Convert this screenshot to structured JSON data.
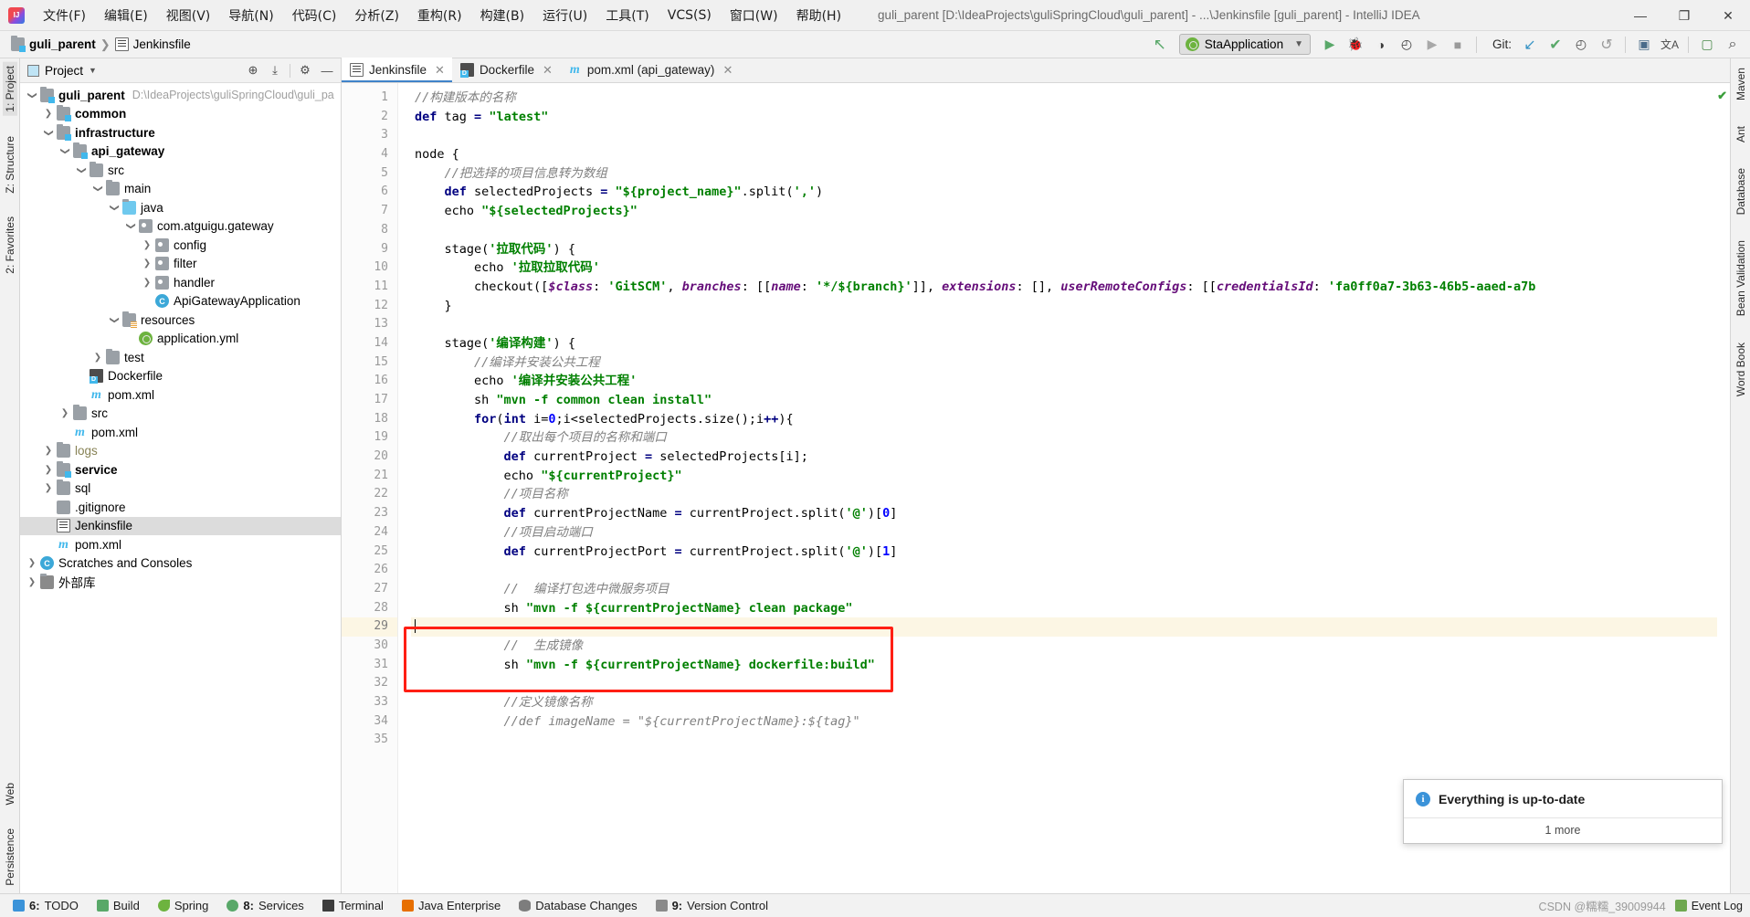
{
  "titlebar": {
    "menus": [
      {
        "label": "文件(F)"
      },
      {
        "label": "编辑(E)"
      },
      {
        "label": "视图(V)"
      },
      {
        "label": "导航(N)"
      },
      {
        "label": "代码(C)"
      },
      {
        "label": "分析(Z)"
      },
      {
        "label": "重构(R)"
      },
      {
        "label": "构建(B)"
      },
      {
        "label": "运行(U)"
      },
      {
        "label": "工具(T)"
      },
      {
        "label": "VCS(S)"
      },
      {
        "label": "窗口(W)"
      },
      {
        "label": "帮助(H)"
      }
    ],
    "window_title": "guli_parent [D:\\IdeaProjects\\guliSpringCloud\\guli_parent] - ...\\Jenkinsfile [guli_parent] - IntelliJ IDEA",
    "minimize": "—",
    "maximize": "❐",
    "close": "✕"
  },
  "toolbar": {
    "breadcrumb": [
      {
        "label": "guli_parent",
        "icon": "module-folder-icon"
      },
      {
        "label": "Jenkinsfile",
        "icon": "jenkins-file-icon"
      }
    ],
    "build_label": "↖",
    "run_config": "StaApplication",
    "run_label": "▶",
    "debug_label": "🐞",
    "coverage_label": "◑",
    "profile_label": "◴",
    "rerun_label": "▶",
    "stop_label": "■",
    "git_label": "Git:",
    "git_update": "↙",
    "git_commit": "✔",
    "git_history": "◴",
    "git_rollback": "↺",
    "project_structure": "▣",
    "translate": "文A",
    "browser": "▢",
    "search": "⌕"
  },
  "left_rail": {
    "top": [
      {
        "label": "1: Project",
        "active": true
      },
      {
        "label": "Z: Structure",
        "active": false
      },
      {
        "label": "2: Favorites",
        "active": false
      }
    ],
    "bottom": [
      {
        "label": "Web"
      },
      {
        "label": "Persistence"
      }
    ]
  },
  "right_rail": {
    "items": [
      {
        "label": "Maven"
      },
      {
        "label": "Ant"
      },
      {
        "label": "Database"
      },
      {
        "label": "Bean Validation"
      },
      {
        "label": "Word Book"
      }
    ]
  },
  "project_panel": {
    "title": "Project",
    "icons": {
      "locate": "⊕",
      "collapse": "⤓",
      "settings": "⚙",
      "hide": "—"
    },
    "tree": [
      {
        "depth": 0,
        "twisty": "open",
        "icon": "module-folder-icon",
        "label": "guli_parent",
        "bold": true,
        "path": "D:\\IdeaProjects\\guliSpringCloud\\guli_pa"
      },
      {
        "depth": 1,
        "twisty": "closed",
        "icon": "module-folder-icon",
        "label": "common",
        "bold": true,
        "path": ""
      },
      {
        "depth": 1,
        "twisty": "open",
        "icon": "module-folder-icon",
        "label": "infrastructure",
        "bold": true,
        "path": ""
      },
      {
        "depth": 2,
        "twisty": "open",
        "icon": "module-folder-icon",
        "label": "api_gateway",
        "bold": true,
        "path": ""
      },
      {
        "depth": 3,
        "twisty": "open",
        "icon": "folder-icon",
        "label": "src",
        "bold": false,
        "path": ""
      },
      {
        "depth": 4,
        "twisty": "open",
        "icon": "folder-icon",
        "label": "main",
        "bold": false,
        "path": ""
      },
      {
        "depth": 5,
        "twisty": "open",
        "icon": "source-folder-icon",
        "label": "java",
        "bold": false,
        "path": ""
      },
      {
        "depth": 6,
        "twisty": "open",
        "icon": "package-icon",
        "label": "com.atguigu.gateway",
        "bold": false,
        "path": ""
      },
      {
        "depth": 7,
        "twisty": "closed",
        "icon": "package-icon",
        "label": "config",
        "bold": false,
        "path": ""
      },
      {
        "depth": 7,
        "twisty": "closed",
        "icon": "package-icon",
        "label": "filter",
        "bold": false,
        "path": ""
      },
      {
        "depth": 7,
        "twisty": "closed",
        "icon": "package-icon",
        "label": "handler",
        "bold": false,
        "path": ""
      },
      {
        "depth": 7,
        "twisty": "none",
        "icon": "spring-class-icon",
        "label": "ApiGatewayApplication",
        "bold": false,
        "path": ""
      },
      {
        "depth": 5,
        "twisty": "open",
        "icon": "resources-folder-icon",
        "label": "resources",
        "bold": false,
        "path": ""
      },
      {
        "depth": 6,
        "twisty": "none",
        "icon": "spring-yml-icon",
        "label": "application.yml",
        "bold": false,
        "path": ""
      },
      {
        "depth": 4,
        "twisty": "closed",
        "icon": "folder-icon",
        "label": "test",
        "bold": false,
        "path": ""
      },
      {
        "depth": 3,
        "twisty": "none",
        "icon": "docker-file-icon",
        "label": "Dockerfile",
        "bold": false,
        "path": ""
      },
      {
        "depth": 3,
        "twisty": "none",
        "icon": "maven-file-icon",
        "label": "pom.xml",
        "bold": false,
        "path": ""
      },
      {
        "depth": 2,
        "twisty": "closed",
        "icon": "folder-icon",
        "label": "src",
        "bold": false,
        "path": ""
      },
      {
        "depth": 2,
        "twisty": "none",
        "icon": "maven-file-icon",
        "label": "pom.xml",
        "bold": false,
        "path": ""
      },
      {
        "depth": 1,
        "twisty": "closed",
        "icon": "folder-icon",
        "label": "logs",
        "bold": false,
        "gray": true,
        "path": ""
      },
      {
        "depth": 1,
        "twisty": "closed",
        "icon": "module-folder-icon",
        "label": "service",
        "bold": true,
        "path": ""
      },
      {
        "depth": 1,
        "twisty": "closed",
        "icon": "folder-icon",
        "label": "sql",
        "bold": false,
        "path": ""
      },
      {
        "depth": 1,
        "twisty": "none",
        "icon": "git-file-icon",
        "label": ".gitignore",
        "bold": false,
        "path": ""
      },
      {
        "depth": 1,
        "twisty": "none",
        "icon": "jenkins-file-icon",
        "label": "Jenkinsfile",
        "bold": false,
        "selected": true,
        "path": ""
      },
      {
        "depth": 1,
        "twisty": "none",
        "icon": "maven-file-icon",
        "label": "pom.xml",
        "bold": false,
        "path": ""
      },
      {
        "depth": 0,
        "twisty": "closed",
        "icon": "scratches-icon",
        "label": "Scratches and Consoles",
        "bold": false,
        "path": ""
      },
      {
        "depth": 0,
        "twisty": "closed",
        "icon": "library-icon",
        "label": "外部库",
        "bold": false,
        "path": ""
      }
    ]
  },
  "editor": {
    "tabs": [
      {
        "label": "Jenkinsfile",
        "icon": "jenkins-file-icon",
        "active": true,
        "close": "✕"
      },
      {
        "label": "Dockerfile",
        "icon": "docker-file-icon",
        "active": false,
        "close": "✕"
      },
      {
        "label": "pom.xml (api_gateway)",
        "icon": "maven-file-icon",
        "active": false,
        "close": "✕"
      }
    ],
    "first_line": 1,
    "last_line": 35,
    "current_line": 29,
    "inspection_status": "✔",
    "lines": [
      {
        "n": 1,
        "html": "<span class='cmt'>//构建版本的名称</span>"
      },
      {
        "n": 2,
        "html": "<span class='kw'>def</span> <span class='plain'>tag </span><span class='kw'>=</span> <span class='str'>\"latest\"</span>"
      },
      {
        "n": 3,
        "html": ""
      },
      {
        "n": 4,
        "html": "<span class='plain'>node {</span>"
      },
      {
        "n": 5,
        "html": "    <span class='cmt'>//把选择的项目信息转为数组</span>"
      },
      {
        "n": 6,
        "html": "    <span class='kw'>def</span> <span class='plain'>selectedProjects </span><span class='kw'>=</span> <span class='str'>\"${project_name}\"</span><span class='plain'>.split(</span><span class='str'>','</span><span class='plain'>)</span>"
      },
      {
        "n": 7,
        "html": "    <span class='plain'>echo </span><span class='str'>\"${selectedProjects}\"</span>"
      },
      {
        "n": 8,
        "html": ""
      },
      {
        "n": 9,
        "html": "    <span class='plain'>stage(</span><span class='str'>'拉取代码'</span><span class='plain'>) {</span>"
      },
      {
        "n": 10,
        "html": "        <span class='plain'>echo </span><span class='str'>'拉取拉取代码'</span>"
      },
      {
        "n": 11,
        "html": "        <span class='plain'>checkout([</span><span class='fld'>$class</span><span class='plain'>: </span><span class='str'>'GitSCM'</span><span class='plain'>, </span><span class='fld'>branches</span><span class='plain'>: [[</span><span class='fld'>name</span><span class='plain'>: </span><span class='str'>'*/${branch}'</span><span class='plain'>]], </span><span class='fld'>extensions</span><span class='plain'>: [], </span><span class='fld'>userRemoteConfigs</span><span class='plain'>: [[</span><span class='fld'>credentialsId</span><span class='plain'>: </span><span class='str'>'fa0ff0a7-3b63-46b5-aaed-a7b</span>"
      },
      {
        "n": 12,
        "html": "    <span class='plain'>}</span>"
      },
      {
        "n": 13,
        "html": ""
      },
      {
        "n": 14,
        "html": "    <span class='plain'>stage(</span><span class='str'>'编译构建'</span><span class='plain'>) {</span>"
      },
      {
        "n": 15,
        "html": "        <span class='cmt'>//编译并安装公共工程</span>"
      },
      {
        "n": 16,
        "html": "        <span class='plain'>echo </span><span class='str'>'编译并安装公共工程'</span>"
      },
      {
        "n": 17,
        "html": "        <span class='plain'>sh </span><span class='str'>\"mvn -f common clean install\"</span>"
      },
      {
        "n": 18,
        "html": "        <span class='kw'>for</span><span class='plain'>(</span><span class='kw'>int</span> <span class='plain'>i=</span><span class='num'>0</span><span class='plain'>;i&lt;selectedProjects.size();i</span><span class='kw'>++</span><span class='plain'>){</span>"
      },
      {
        "n": 19,
        "html": "            <span class='cmt'>//取出每个项目的名称和端口</span>"
      },
      {
        "n": 20,
        "html": "            <span class='kw'>def</span> <span class='plain'>currentProject </span><span class='kw'>=</span> <span class='plain'>selectedProjects[i];</span>"
      },
      {
        "n": 21,
        "html": "            <span class='plain'>echo </span><span class='str'>\"${currentProject}\"</span>"
      },
      {
        "n": 22,
        "html": "            <span class='cmt'>//项目名称</span>"
      },
      {
        "n": 23,
        "html": "            <span class='kw'>def</span> <span class='plain'>currentProjectName </span><span class='kw'>=</span> <span class='plain'>currentProject.split(</span><span class='str'>'@'</span><span class='plain'>)[</span><span class='num'>0</span><span class='plain'>]</span>"
      },
      {
        "n": 24,
        "html": "            <span class='cmt'>//项目启动端口</span>"
      },
      {
        "n": 25,
        "html": "            <span class='kw'>def</span> <span class='plain'>currentProjectPort </span><span class='kw'>=</span> <span class='plain'>currentProject.split(</span><span class='str'>'@'</span><span class='plain'>)[</span><span class='num'>1</span><span class='plain'>]</span>"
      },
      {
        "n": 26,
        "html": ""
      },
      {
        "n": 27,
        "html": "            <span class='cmt'>//  编译打包选中微服务项目</span>"
      },
      {
        "n": 28,
        "html": "            <span class='plain'>sh </span><span class='str'>\"mvn -f ${currentProjectName} clean package\"</span>"
      },
      {
        "n": 29,
        "html": "<span class='caret-slot'></span>"
      },
      {
        "n": 30,
        "html": "            <span class='cmt'>//  生成镜像</span>"
      },
      {
        "n": 31,
        "html": "            <span class='plain'>sh </span><span class='str'>\"mvn -f ${currentProjectName} dockerfile:build\"</span>"
      },
      {
        "n": 32,
        "html": ""
      },
      {
        "n": 33,
        "html": "            <span class='cmt'>//定义镜像名称</span>"
      },
      {
        "n": 34,
        "html": "            <span class='cmt'>//def imageName = \"${currentProjectName}:${tag}\"</span>"
      },
      {
        "n": 35,
        "html": ""
      }
    ]
  },
  "notification": {
    "title": "Everything is up-to-date",
    "more": "1 more"
  },
  "statusbar": {
    "items": [
      {
        "num": "6:",
        "label": "TODO",
        "icon": "todo-icon"
      },
      {
        "num": "",
        "label": "Build",
        "icon": "build-icon"
      },
      {
        "num": "",
        "label": "Spring",
        "icon": "spring-icon"
      },
      {
        "num": "8:",
        "label": "Services",
        "icon": "services-icon"
      },
      {
        "num": "",
        "label": "Terminal",
        "icon": "terminal-icon"
      },
      {
        "num": "",
        "label": "Java Enterprise",
        "icon": "java-icon"
      },
      {
        "num": "",
        "label": "Database Changes",
        "icon": "database-icon"
      },
      {
        "num": "9:",
        "label": "Version Control",
        "icon": "vcs-icon"
      }
    ],
    "event_log": "Event Log",
    "watermark": "CSDN @糯糯_39009944"
  },
  "colors": {
    "accent": "#4083c9",
    "highlight_box": "#ff1f14",
    "current_line": "#fcf6e4",
    "string": "#008000",
    "keyword": "#000080",
    "comment": "#808080",
    "field": "#660e7a",
    "selection": "#dcdcdc"
  }
}
